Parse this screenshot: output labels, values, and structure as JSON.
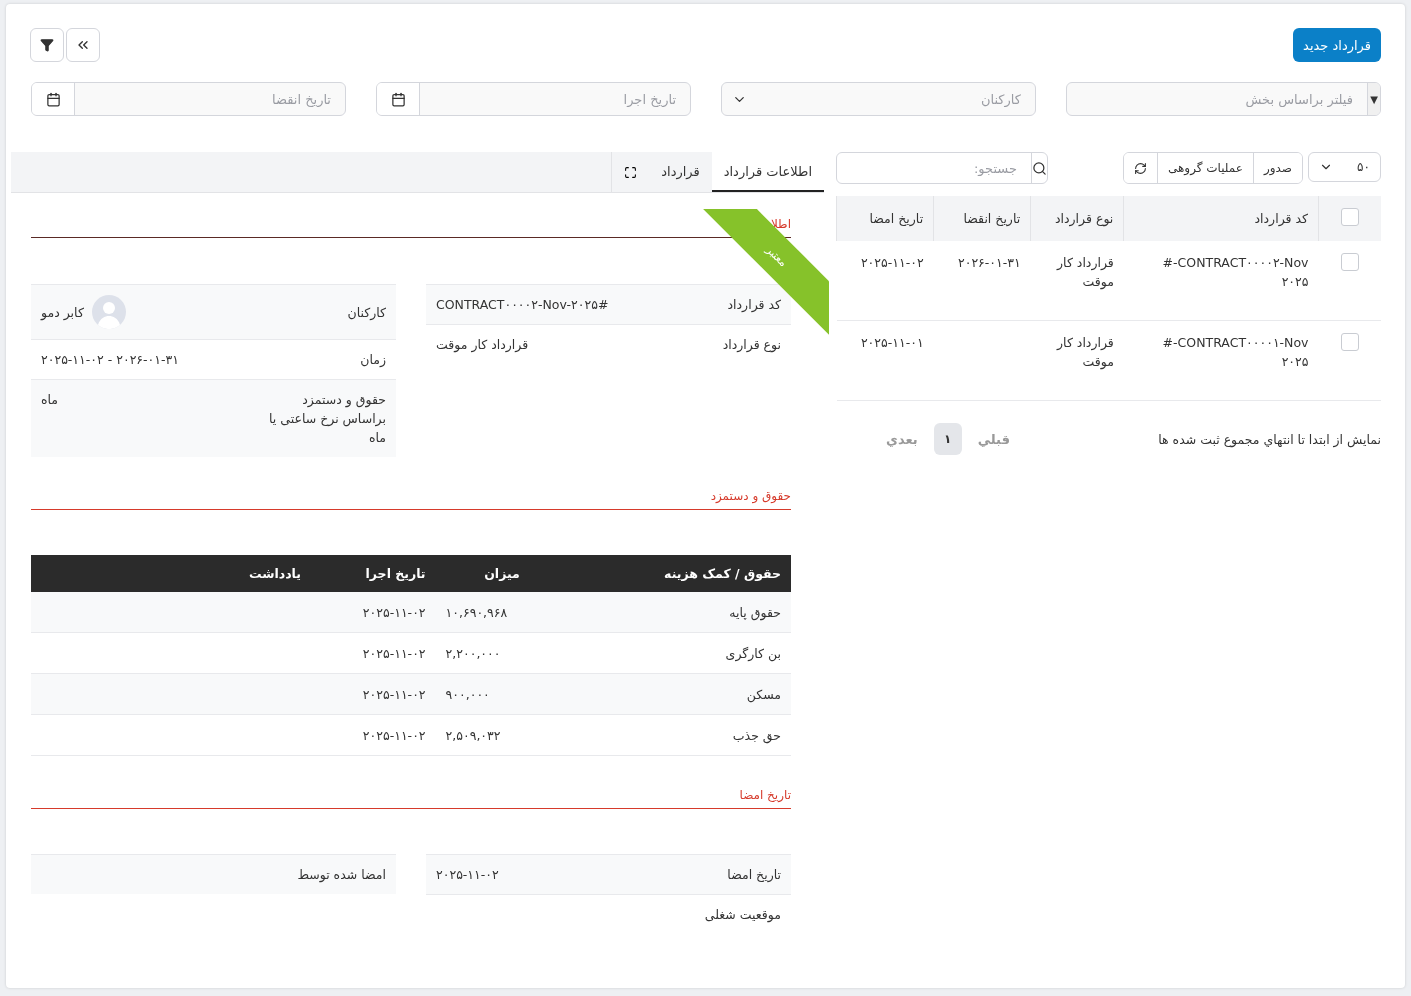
{
  "toolbar": {
    "new_button": "قرارداد جدید"
  },
  "filters": [
    {
      "kind": "select",
      "placeholder": "فیلتر براساس بخش",
      "caret": "▼"
    },
    {
      "kind": "dropdown",
      "placeholder": "کارکنان"
    },
    {
      "kind": "date",
      "placeholder": "تاریخ اجرا"
    },
    {
      "kind": "date",
      "placeholder": "تاریخ انقضا"
    }
  ],
  "list": {
    "page_size": "۵۰",
    "buttons": [
      "صدور",
      "عملیات گروهی"
    ],
    "search_placeholder": "جستجو:",
    "all_checked": false,
    "columns": [
      "کد قرارداد",
      "نوع قرارداد",
      "تاریخ انقضا",
      "تاریخ امضا"
    ],
    "rows": [
      {
        "checked": false,
        "cells": [
          "CONTRACT۰۰۰۰۲-Nov-#\n۲۰۲۵",
          "قرارداد کار\nموقت",
          "۲۰۲۶-۰۱-۳۱",
          "۲۰۲۵-۱۱-۰۲"
        ]
      },
      {
        "checked": false,
        "cells": [
          "CONTRACT۰۰۰۰۱-Nov-#\n۲۰۲۵",
          "قرارداد کار\nموقت",
          "",
          "۲۰۲۵-۱۱-۰۱"
        ]
      }
    ],
    "footer": "نمایش از ابتدا تا انتهاي مجموع ثبت شده ها",
    "pagination": {
      "prev": "قبلي",
      "pages": [
        {
          "label": "۱",
          "selected": true
        }
      ],
      "next": "بعدي"
    }
  },
  "detail": {
    "tabs": [
      {
        "label": "اطلاعات قرارداد",
        "selected": true
      },
      {
        "label": "قرارداد",
        "selected": false
      }
    ],
    "ribbon": "معتبر",
    "section_info": "اطلا",
    "info_right": [
      {
        "label": "کد قرارداد",
        "value": "CONTRACT۰۰۰۰۲-Nov-۲۰۲۵#"
      },
      {
        "label": "نوع قرارداد",
        "value": "قرارداد کار موقت"
      }
    ],
    "info_left": [
      {
        "label": "کارکنان",
        "value": "کابر دمو",
        "avatar": true
      },
      {
        "label": "زمان",
        "value": "۲۰۲۶-۰۱-۳۱ - ۲۰۲۵-۱۱-۰۲"
      },
      {
        "label": "حقوق و دستمزد\nبراساس نرخ ساعتی یا\nماه",
        "value": "ماه"
      }
    ],
    "section_salary": "حقوق و دستمزد",
    "salary_columns": [
      "حقوق / کمک هزینه",
      "میزان",
      "تاریخ اجرا",
      "يادداشت"
    ],
    "salary_rows": [
      [
        "حقوق پایه",
        "۱۰,۶۹۰,۹۶۸",
        "۲۰۲۵-۱۱-۰۲"
      ],
      [
        "بن کارگری",
        "۲,۲۰۰,۰۰۰",
        "۲۰۲۵-۱۱-۰۲"
      ],
      [
        "مسکن",
        "۹۰۰,۰۰۰",
        "۲۰۲۵-۱۱-۰۲"
      ],
      [
        "حق جذب",
        "۲,۵۰۹,۰۳۲",
        "۲۰۲۵-۱۱-۰۲"
      ]
    ],
    "section_sign": "تاریخ امضا",
    "sign_right": [
      {
        "label": "تاریخ امضا",
        "value": "۲۰۲۵-۱۱-۰۲"
      },
      {
        "label": "موقعیت شغلی"
      }
    ],
    "sign_left": [
      {
        "label": "امضا شده توسط"
      }
    ]
  }
}
